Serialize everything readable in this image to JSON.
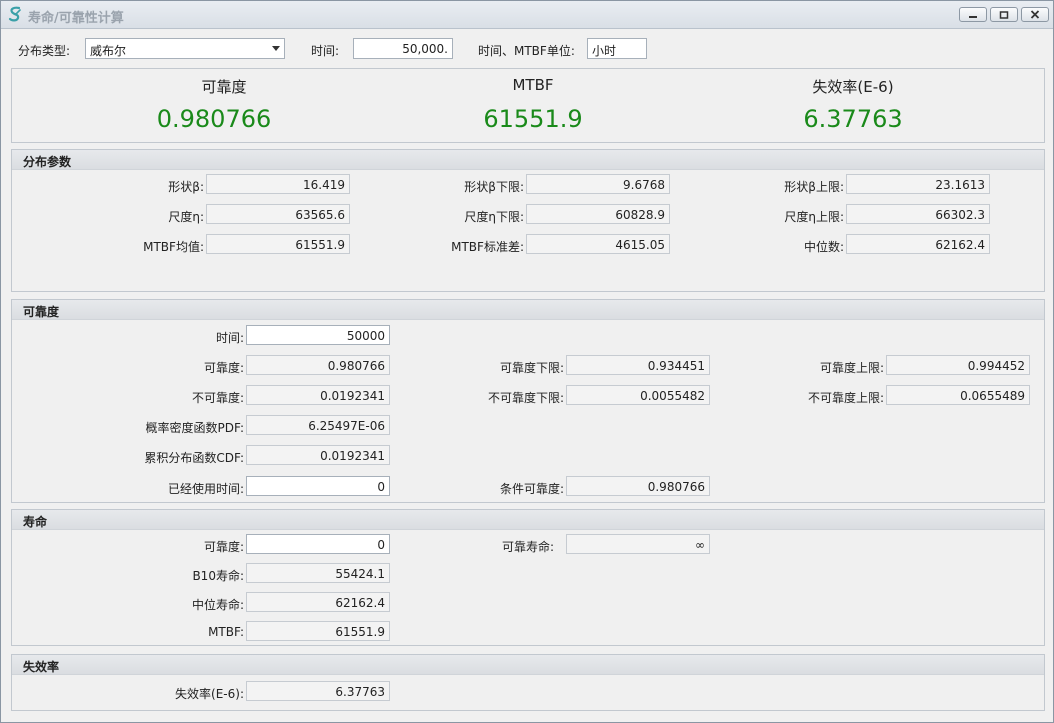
{
  "window": {
    "title": "寿命/可靠性计算"
  },
  "toolbar": {
    "dist_label": "分布类型:",
    "dist_value": "威布尔",
    "time_label": "时间:",
    "time_value": "50,000.",
    "unit_label": "时间、MTBF单位:",
    "unit_value": "小时"
  },
  "summary": {
    "reliability_label": "可靠度",
    "reliability_value": "0.980766",
    "mtbf_label": "MTBF",
    "mtbf_value": "61551.9",
    "failure_label": "失效率(E-6)",
    "failure_value": "6.37763"
  },
  "params": {
    "title": "分布参数",
    "shape_label": "形状β:",
    "shape": "16.419",
    "shape_low_label": "形状β下限:",
    "shape_low": "9.6768",
    "shape_high_label": "形状β上限:",
    "shape_high": "23.1613",
    "scale_label": "尺度η:",
    "scale": "63565.6",
    "scale_low_label": "尺度η下限:",
    "scale_low": "60828.9",
    "scale_high_label": "尺度η上限:",
    "scale_high": "66302.3",
    "mtbf_mean_label": "MTBF均值:",
    "mtbf_mean": "61551.9",
    "mtbf_std_label": "MTBF标准差:",
    "mtbf_std": "4615.05",
    "median_label": "中位数:",
    "median": "62162.4"
  },
  "reliability": {
    "title": "可靠度",
    "time_label": "时间:",
    "time": "50000",
    "rel_label": "可靠度:",
    "rel": "0.980766",
    "rel_low_label": "可靠度下限:",
    "rel_low": "0.934451",
    "rel_high_label": "可靠度上限:",
    "rel_high": "0.994452",
    "unrel_label": "不可靠度:",
    "unrel": "0.0192341",
    "unrel_low_label": "不可靠度下限:",
    "unrel_low": "0.0055482",
    "unrel_high_label": "不可靠度上限:",
    "unrel_high": "0.0655489",
    "pdf_label": "概率密度函数PDF:",
    "pdf": "6.25497E-06",
    "cdf_label": "累积分布函数CDF:",
    "cdf": "0.0192341",
    "used_label": "已经使用时间:",
    "used": "0",
    "cond_label": "条件可靠度:",
    "cond": "0.980766"
  },
  "life": {
    "title": "寿命",
    "rel_label": "可靠度:",
    "rel": "0",
    "rel_life_label": "可靠寿命:",
    "rel_life": "∞",
    "b10_label": "B10寿命:",
    "b10": "55424.1",
    "median_label": "中位寿命:",
    "median": "62162.4",
    "mtbf_label": "MTBF:",
    "mtbf": "61551.9"
  },
  "failure": {
    "title": "失效率",
    "rate_label": "失效率(E-6):",
    "rate": "6.37763"
  },
  "colors": {
    "accent_green": "#1a8a1a",
    "title_gray": "#9aa3ad"
  }
}
